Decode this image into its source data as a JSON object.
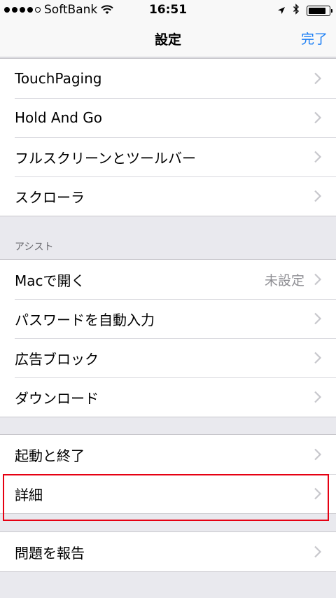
{
  "status_bar": {
    "carrier": "SoftBank",
    "time": "16:51",
    "signal_bars_filled": 4,
    "signal_bars_total": 5,
    "battery_level": 0.85
  },
  "nav": {
    "title": "設定",
    "done_label": "完了"
  },
  "groups": {
    "first": {
      "rows": [
        {
          "label": "TouchPaging"
        },
        {
          "label": "Hold And Go"
        },
        {
          "label": "フルスクリーンとツールバー"
        },
        {
          "label": "スクローラ"
        }
      ]
    },
    "assist": {
      "header": "アシスト",
      "rows": [
        {
          "label": "Macで開く",
          "value": "未設定"
        },
        {
          "label": "パスワードを自動入力"
        },
        {
          "label": "広告ブロック"
        },
        {
          "label": "ダウンロード"
        }
      ]
    },
    "third": {
      "rows": [
        {
          "label": "起動と終了"
        },
        {
          "label": "詳細"
        }
      ]
    },
    "fourth": {
      "rows": [
        {
          "label": "問題を報告"
        }
      ]
    }
  },
  "colors": {
    "accent": "#1a7ef5",
    "highlight": "#e60012",
    "background": "#e9e9ee"
  },
  "icons": {
    "wifi": "wifi-icon",
    "location": "location-arrow-icon",
    "bluetooth": "bluetooth-icon",
    "battery": "battery-icon",
    "chevron": "chevron-right-icon"
  }
}
